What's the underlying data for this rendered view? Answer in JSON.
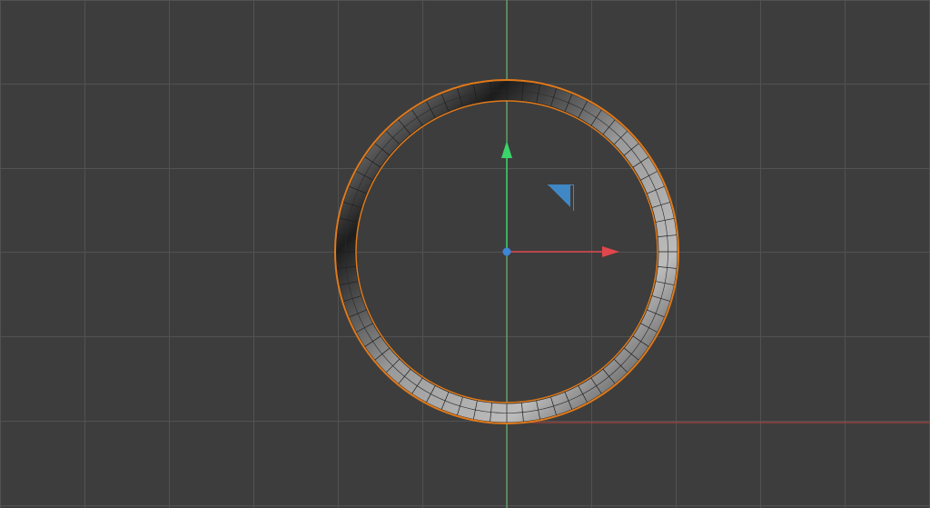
{
  "viewport": {
    "view": "top-orthographic",
    "background_color": "#3d3d3d",
    "grid_color": "#525252",
    "x_axis_color": "#b3443a",
    "y_axis_color": "#6cc27a",
    "selection_outline_color": "#e07a1a"
  },
  "object": {
    "type": "ring-mesh",
    "selected": true,
    "segments": 64,
    "face_color_light": "#bcbcbc",
    "face_color_dark": "#1c1c1c"
  },
  "gizmo": {
    "type": "translate",
    "x_arrow_color": "#e0474c",
    "y_arrow_color": "#3bd36a",
    "center_color": "#3d86d8",
    "plane_handle_color": "#3f88c5",
    "plane_handle_icon": "xy-plane-handle-icon"
  }
}
